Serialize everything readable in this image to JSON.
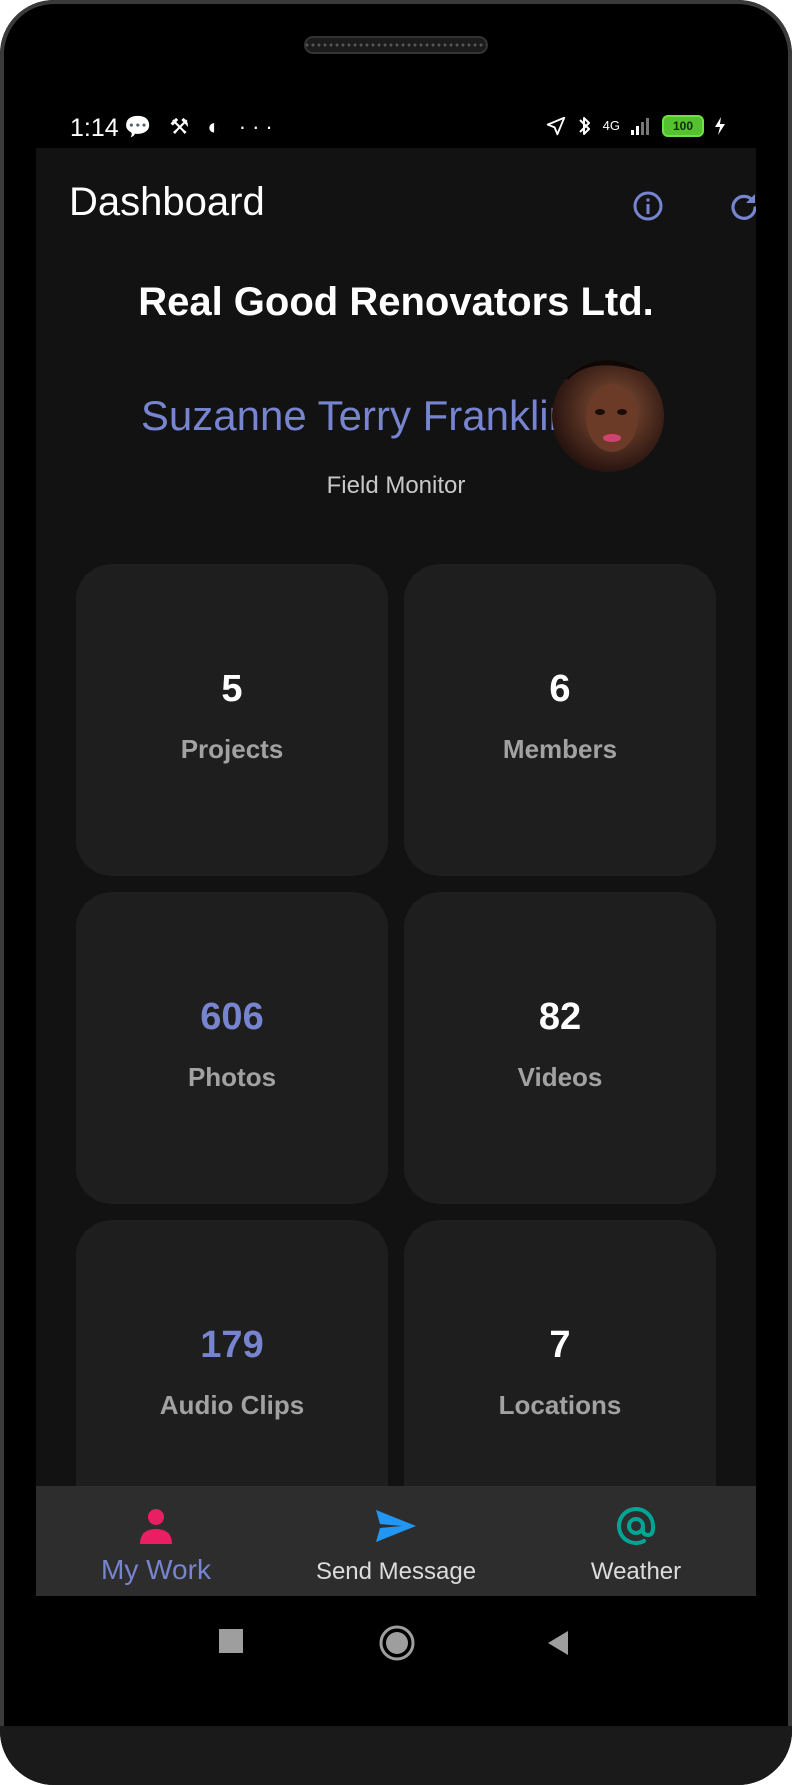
{
  "status_bar": {
    "time": "1:14",
    "left_icons": "💬 ⚒ ◐ ···",
    "signal": "4G",
    "battery": "100"
  },
  "app_bar": {
    "title": "Dashboard",
    "info_icon": "info-icon",
    "refresh_icon": "refresh-icon"
  },
  "profile": {
    "company": "Real Good Renovators Ltd.",
    "name": "Suzanne Terry Franklin",
    "role": "Field Monitor"
  },
  "stats": [
    {
      "value": "5",
      "label": "Projects",
      "accent": false
    },
    {
      "value": "6",
      "label": "Members",
      "accent": false
    },
    {
      "value": "606",
      "label": "Photos",
      "accent": true
    },
    {
      "value": "82",
      "label": "Videos",
      "accent": false
    },
    {
      "value": "179",
      "label": "Audio Clips",
      "accent": true
    },
    {
      "value": "7",
      "label": "Locations",
      "accent": false
    }
  ],
  "bottom_nav": {
    "items": [
      {
        "label": "My Work",
        "icon": "person-icon",
        "active": true
      },
      {
        "label": "Send Message",
        "icon": "send-icon",
        "active": false
      },
      {
        "label": "Weather",
        "icon": "at-sign-icon",
        "active": false
      }
    ]
  },
  "colors": {
    "accent": "#7784cf",
    "background": "#121212",
    "card": "#1e1e1e",
    "nav_bar": "#2d2d2d",
    "person_icon": "#e91e63",
    "send_icon": "#2196f3",
    "weather_icon": "#00a693"
  }
}
